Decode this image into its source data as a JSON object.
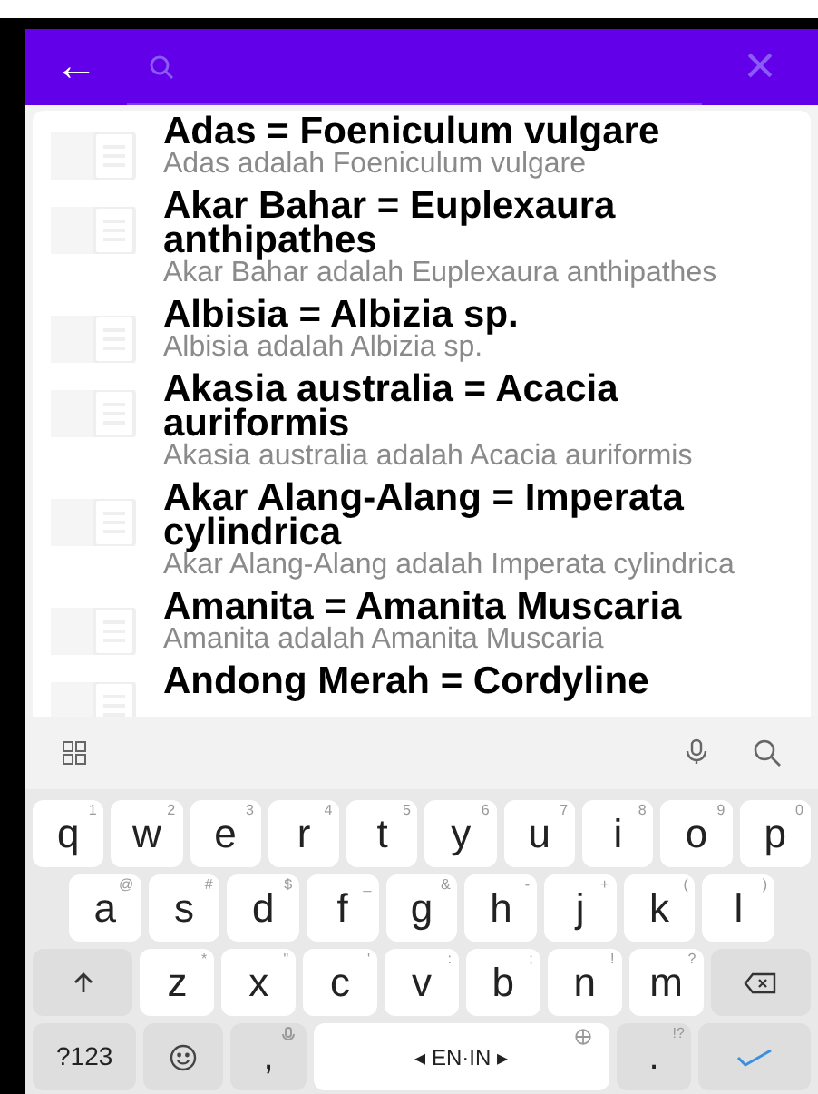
{
  "search_bar": {
    "back_icon": "←",
    "clear_icon": "×"
  },
  "results": [
    {
      "title": "Adas = Foeniculum vulgare",
      "subtitle": "Adas adalah Foeniculum vulgare"
    },
    {
      "title": "Akar Bahar = Euplexaura anthipathes",
      "subtitle": "Akar Bahar adalah Euplexaura anthipathes"
    },
    {
      "title": "Albisia = Albizia sp.",
      "subtitle": "Albisia adalah Albizia sp."
    },
    {
      "title": "Akasia australia = Acacia auriformis",
      "subtitle": "Akasia australia adalah Acacia auriformis"
    },
    {
      "title": "Akar Alang-Alang = Imperata cylindrica",
      "subtitle": "Akar Alang-Alang adalah Imperata cylindrica"
    },
    {
      "title": "Amanita = Amanita Muscaria",
      "subtitle": "Amanita adalah Amanita Muscaria"
    },
    {
      "title": "Andong Merah = Cordyline"
    }
  ],
  "keyboard": {
    "rows": [
      {
        "keys": [
          {
            "label": "q",
            "hint": "1"
          },
          {
            "label": "w",
            "hint": "2"
          },
          {
            "label": "e",
            "hint": "3"
          },
          {
            "label": "r",
            "hint": "4"
          },
          {
            "label": "t",
            "hint": "5"
          },
          {
            "label": "y",
            "hint": "6"
          },
          {
            "label": "u",
            "hint": "7"
          },
          {
            "label": "i",
            "hint": "8"
          },
          {
            "label": "o",
            "hint": "9"
          },
          {
            "label": "p",
            "hint": "0"
          }
        ]
      },
      {
        "keys": [
          {
            "label": "a",
            "hint": "@"
          },
          {
            "label": "s",
            "hint": "#"
          },
          {
            "label": "d",
            "hint": "$"
          },
          {
            "label": "f",
            "hint": "_"
          },
          {
            "label": "g",
            "hint": "&"
          },
          {
            "label": "h",
            "hint": "-"
          },
          {
            "label": "j",
            "hint": "+"
          },
          {
            "label": "k",
            "hint": "("
          },
          {
            "label": "l",
            "hint": ")"
          }
        ]
      },
      {
        "keys": [
          {
            "kind": "shift"
          },
          {
            "label": "z",
            "hint": "*"
          },
          {
            "label": "x",
            "hint": "\""
          },
          {
            "label": "c",
            "hint": "'"
          },
          {
            "label": "v",
            "hint": ":"
          },
          {
            "label": "b",
            "hint": ";"
          },
          {
            "label": "n",
            "hint": "!"
          },
          {
            "label": "m",
            "hint": "?"
          },
          {
            "kind": "backspace"
          }
        ]
      },
      {
        "keys": [
          {
            "kind": "symbols",
            "label": "?123"
          },
          {
            "kind": "emoji"
          },
          {
            "kind": "comma",
            "label": ","
          },
          {
            "kind": "space",
            "label": "◂ EN·IN ▸"
          },
          {
            "kind": "period",
            "label": ".",
            "hint": "!?"
          },
          {
            "kind": "enter"
          }
        ]
      }
    ]
  }
}
